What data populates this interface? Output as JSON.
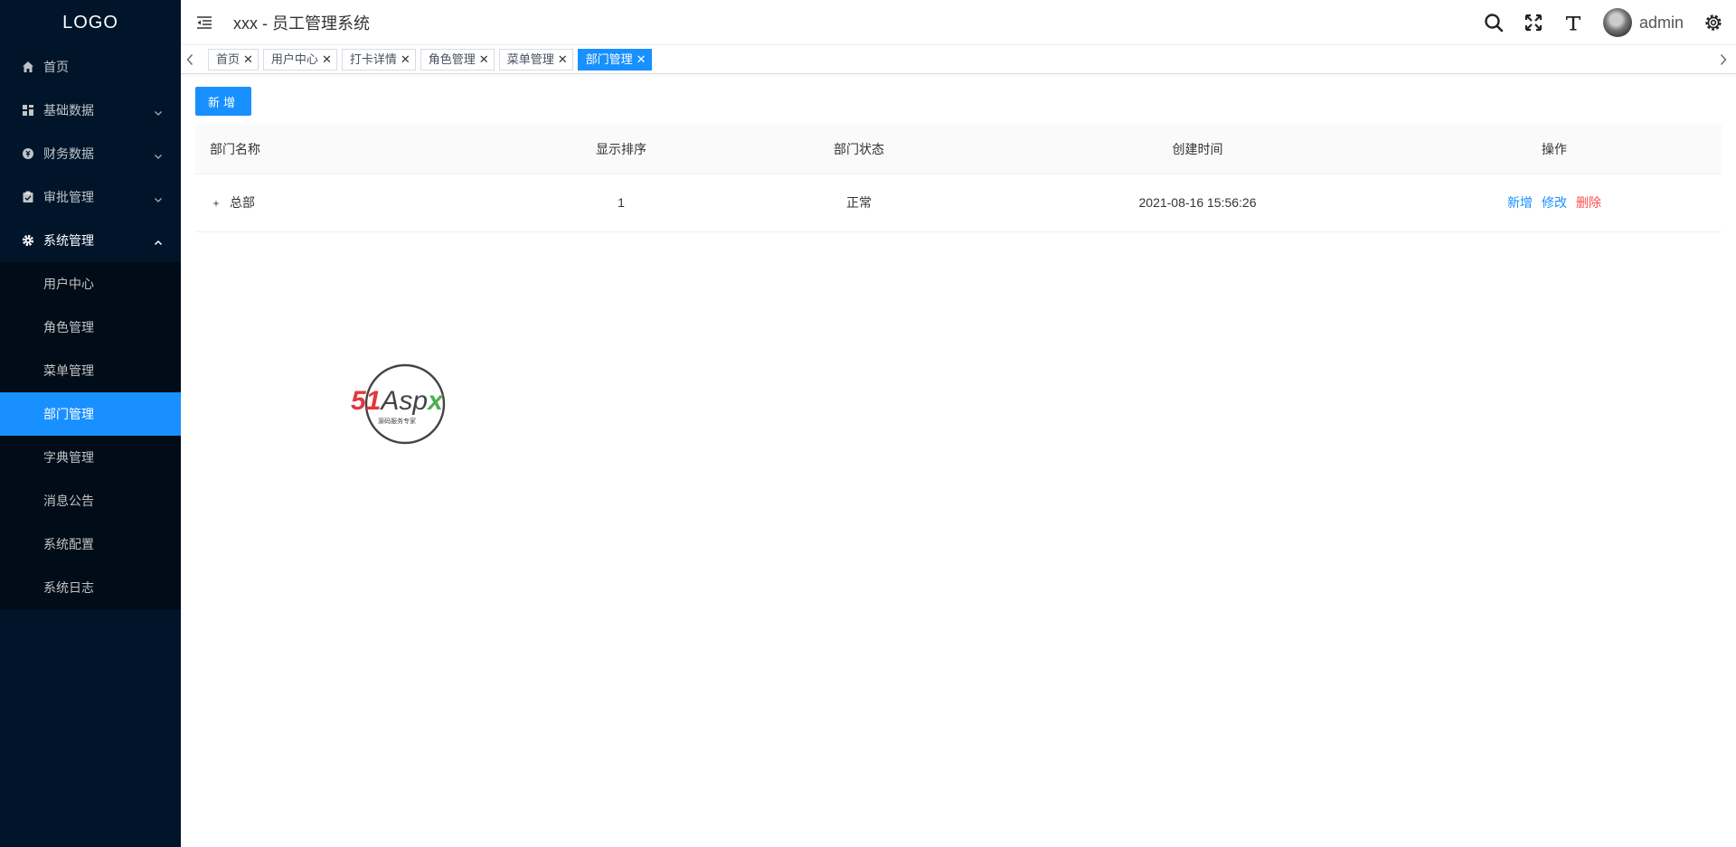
{
  "sidebar": {
    "logo": "LOGO",
    "menu": [
      {
        "label": "首页",
        "icon": "home-icon"
      },
      {
        "label": "基础数据",
        "icon": "grid-icon"
      },
      {
        "label": "财务数据",
        "icon": "money-icon"
      },
      {
        "label": "审批管理",
        "icon": "approve-icon"
      },
      {
        "label": "系统管理",
        "icon": "gear-icon"
      }
    ],
    "submenu": [
      "用户中心",
      "角色管理",
      "菜单管理",
      "部门管理",
      "字典管理",
      "消息公告",
      "系统配置",
      "系统日志"
    ]
  },
  "header": {
    "title": "xxx - 员工管理系统",
    "username": "admin"
  },
  "tabs": [
    {
      "label": "首页"
    },
    {
      "label": "用户中心"
    },
    {
      "label": "打卡详情"
    },
    {
      "label": "角色管理"
    },
    {
      "label": "菜单管理"
    },
    {
      "label": "部门管理"
    }
  ],
  "toolbar": {
    "add_label": "新增"
  },
  "table": {
    "columns": [
      "部门名称",
      "显示排序",
      "部门状态",
      "创建时间",
      "操作"
    ],
    "rows": [
      {
        "name": "总部",
        "sort": "1",
        "status": "正常",
        "created": "2021-08-16 15:56:26",
        "expand": "+"
      }
    ],
    "actions": {
      "add": "新增",
      "edit": "修改",
      "delete": "删除"
    }
  },
  "watermark": {
    "brand": "51Aspx",
    "tagline": "源码服务专家"
  },
  "colors": {
    "primary": "#1890ff",
    "sidebar": "#001529",
    "danger": "#ff4d4f"
  }
}
